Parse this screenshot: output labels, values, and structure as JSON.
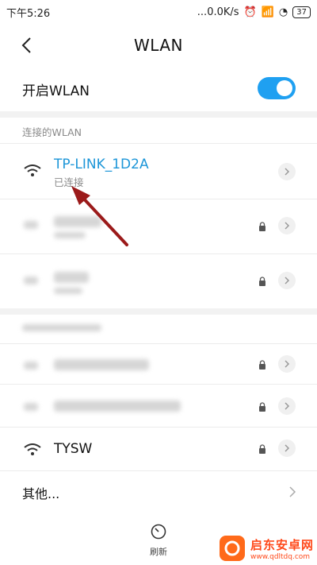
{
  "status_bar": {
    "time": "下午5:26",
    "speed": "...0.0K/s",
    "battery": "37"
  },
  "header": {
    "title": "WLAN"
  },
  "toggle": {
    "label": "开启WLAN",
    "on": true
  },
  "sections": {
    "connected_label": "连接的WLAN"
  },
  "networks": [
    {
      "name": "TP-LINK_1D2A",
      "status": "已连接"
    },
    {
      "name": "TYSW"
    }
  ],
  "other": {
    "label": "其他..."
  },
  "bottom": {
    "refresh_label": "刷新"
  },
  "watermark": {
    "brand": "启东安卓网",
    "url": "www.qdltdq.com"
  },
  "colors": {
    "accent": "#1fa0f1",
    "connected_text": "#1d96d8",
    "arrow": "#9b1a1a"
  }
}
